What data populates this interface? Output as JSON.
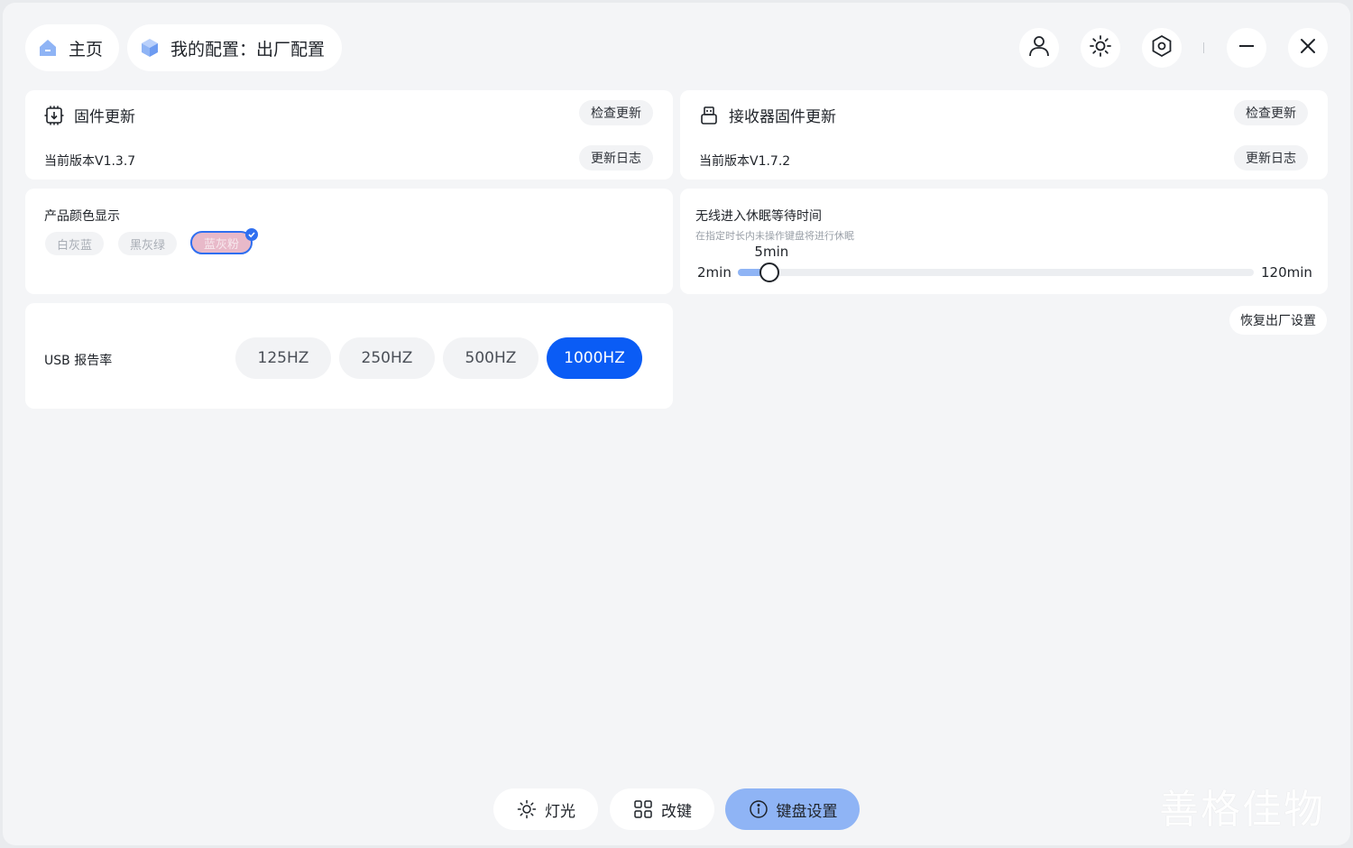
{
  "header": {
    "home_label": "主页",
    "config_label": "我的配置：出厂配置",
    "icons": [
      "user-icon",
      "brightness-icon",
      "settings-icon",
      "minimize-icon",
      "close-icon"
    ]
  },
  "firmware": {
    "title": "固件更新",
    "check_label": "检查更新",
    "version": "当前版本V1.3.7",
    "log_label": "更新日志"
  },
  "receiver": {
    "title": "接收器固件更新",
    "check_label": "检查更新",
    "version": "当前版本V1.7.2",
    "log_label": "更新日志"
  },
  "product_color": {
    "title": "产品颜色显示",
    "options": [
      {
        "label": "白灰蓝",
        "selected": false
      },
      {
        "label": "黑灰绿",
        "selected": false
      },
      {
        "label": "蓝灰粉",
        "selected": true
      }
    ]
  },
  "sleep": {
    "title": "无线进入休眠等待时间",
    "hint": "在指定时长内未操作键盘将进行休眠",
    "min_label": "2min",
    "max_label": "120min",
    "current_label": "5min",
    "min": 2,
    "max": 120,
    "value": 5
  },
  "usb": {
    "title": "USB 报告率",
    "options": [
      {
        "label": "125HZ",
        "active": false
      },
      {
        "label": "250HZ",
        "active": false
      },
      {
        "label": "500HZ",
        "active": false
      },
      {
        "label": "1000HZ",
        "active": true
      }
    ]
  },
  "reset_label": "恢复出厂设置",
  "bottom_nav": {
    "items": [
      {
        "label": "灯光",
        "icon": "sun-icon",
        "active": false
      },
      {
        "label": "改键",
        "icon": "grid-icon",
        "active": false
      },
      {
        "label": "键盘设置",
        "icon": "info-icon",
        "active": true
      }
    ]
  },
  "watermark": "善格佳物",
  "colors": {
    "accent": "#0a5cf5",
    "accent_light": "#8fb4f5",
    "selected_color_chip": "#e8b9c9"
  }
}
